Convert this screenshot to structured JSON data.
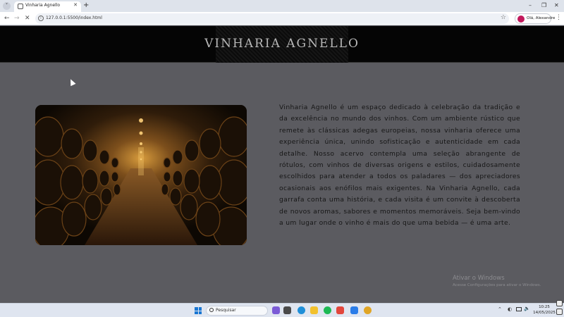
{
  "browser": {
    "tab_title": "Vinharia Agnello",
    "url": "127.0.0.1:5500/index.html",
    "profile_label": "Olá, Alexandre"
  },
  "site": {
    "title": "VINHARIA AGNELLO",
    "about": "Vinharia Agnello é um espaço dedicado à celebração da tradição e da excelência no mundo dos vinhos. Com um ambiente rústico que remete às clássicas adegas europeias, nossa vinharia oferece uma experiência única, unindo sofisticação e autenticidade em cada detalhe. Nosso acervo contempla uma seleção abrangente de rótulos, com vinhos de diversas origens e estilos, cuidadosamente escolhidos para atender a todos os paladares — dos apreciadores ocasionais aos enófilos mais exigentes. Na Vinharia Agnello, cada garrafa conta uma história, e cada visita é um convite à descoberta de novos aromas, sabores e momentos memoráveis. Seja bem-vindo a um lugar onde o vinho é mais do que uma bebida — é uma arte."
  },
  "windows_watermark": {
    "title": "Ativar o Windows",
    "subtitle": "Acesse Configurações para ativar o Windows."
  },
  "taskbar": {
    "search_label": "Pesquisar",
    "time": "10:25",
    "date": "14/05/2025"
  },
  "colors": {
    "header_bg": "#050505",
    "page_bg": "#5b5b60",
    "title_text": "#b8b8b8",
    "body_text": "#161616"
  }
}
